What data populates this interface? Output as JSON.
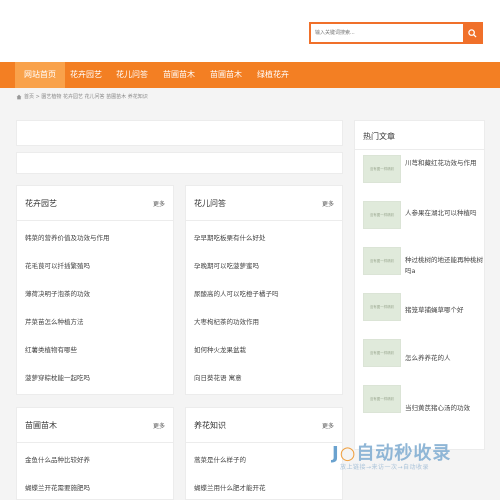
{
  "search": {
    "placeholder": "输入关键词搜索..."
  },
  "nav": {
    "items": [
      "网站首页",
      "花卉园艺",
      "花儿问答",
      "苗圃苗木",
      "苗圃苗木",
      "绿植花卉"
    ]
  },
  "breadcrumb": "首页 > 園艺植物 花卉园艺 花儿问答 苗圃苗木 养花知识",
  "boxes": [
    {
      "title": "花卉园艺",
      "more": "更多",
      "items": [
        "韩菜的营养价值及功效与作用",
        "花毛茛可以扦插繁殖吗",
        "薄荷决明子泡茶的功效",
        "芹菜苗怎么种植方法",
        "红薯类植物有哪些",
        "菠萝穿粽枕能一起吃吗"
      ]
    },
    {
      "title": "花儿问答",
      "more": "更多",
      "items": [
        "孕早期吃板栗有什么好处",
        "孕晚期可以吃菠萝蜜吗",
        "尿酸高的人可以吃橙子橘子吗",
        "大枣枸杞茶的功效作用",
        "如何种火龙果盆栽",
        "向日葵花语 寓意"
      ]
    },
    {
      "title": "苗圃苗木",
      "more": "更多",
      "items": [
        "金鱼什么品种比较好养",
        "蝴蝶兰开花需要施肥吗"
      ]
    },
    {
      "title": "养花知识",
      "more": "更多",
      "items": [
        "蒿菜是什么样子的",
        "蝴蝶兰用什么肥才能开花"
      ]
    }
  ],
  "sidebar": {
    "title": "热门文章",
    "thumb_text": "没有图一样精彩",
    "items": [
      "川芎和藏红花功效与作用",
      "人参果在湖北可以种植吗",
      "种过桃树的地还能再种桃树吗a",
      "猪笼草捕蝇草哪个好",
      "怎么养养花的人",
      "当归黄芪猪心汤的功效"
    ]
  },
  "watermark": {
    "logo": "自动秒收录",
    "sub": "放上链接→来访一次→自动收录"
  }
}
